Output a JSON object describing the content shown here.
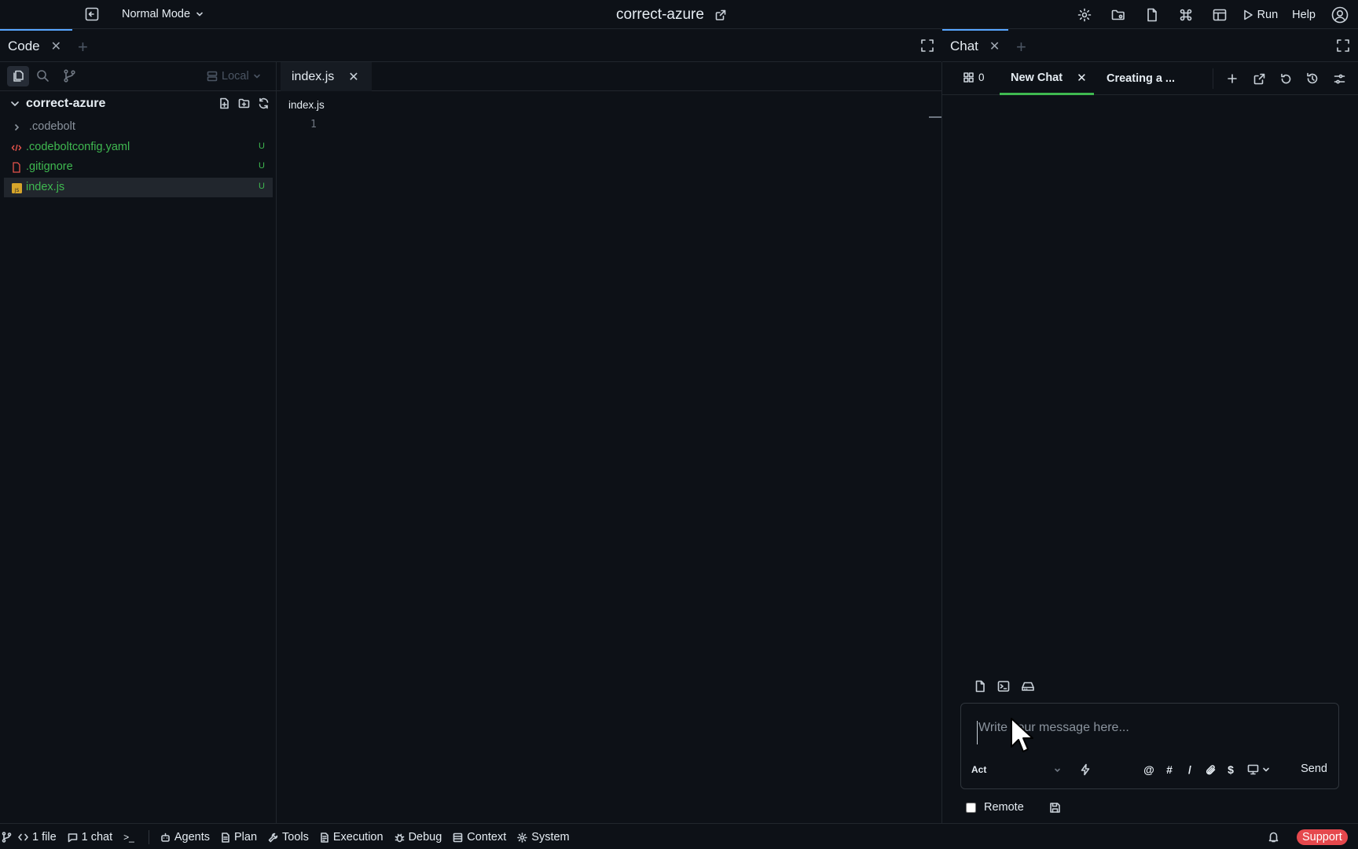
{
  "topbar": {
    "mode_label": "Normal Mode",
    "project_title": "correct-azure",
    "run_label": "Run",
    "help_label": "Help"
  },
  "code_panel": {
    "tab_label": "Code",
    "local_label": "Local"
  },
  "explorer": {
    "project_name": "correct-azure",
    "items": [
      {
        "label": ".codebolt",
        "type": "folder",
        "color": "#8b949e",
        "badge": ""
      },
      {
        "label": ".codeboltconfig.yaml",
        "type": "yaml",
        "color": "#3fb950",
        "badge": "U"
      },
      {
        "label": ".gitignore",
        "type": "file",
        "color": "#3fb950",
        "badge": "U"
      },
      {
        "label": "index.js",
        "type": "js",
        "color": "#3fb950",
        "badge": "U"
      }
    ]
  },
  "editor": {
    "tab_label": "index.js",
    "breadcrumb": "index.js",
    "line_numbers": [
      "1"
    ]
  },
  "chat_panel": {
    "tab_label": "Chat",
    "agents_count": "0",
    "tabs": [
      {
        "label": "New Chat",
        "active": true
      },
      {
        "label": "Creating a ...",
        "active": false
      }
    ],
    "message_placeholder": "Write your message here...",
    "mode_select": "Act",
    "quick_symbols": [
      "@",
      "#",
      "/"
    ],
    "dollar_symbol": "$",
    "send_label": "Send",
    "remote_label": "Remote"
  },
  "statusbar": {
    "files": "1 file",
    "chats": "1 chat",
    "terminal": ">_",
    "items": [
      "Agents",
      "Plan",
      "Tools",
      "Execution",
      "Debug",
      "Context",
      "System"
    ],
    "support_label": "Support"
  },
  "colors": {
    "background": "#0d1117",
    "accent_green": "#3fb950",
    "tab_indicator": "#58a6ff",
    "support_red": "#e5484d"
  }
}
